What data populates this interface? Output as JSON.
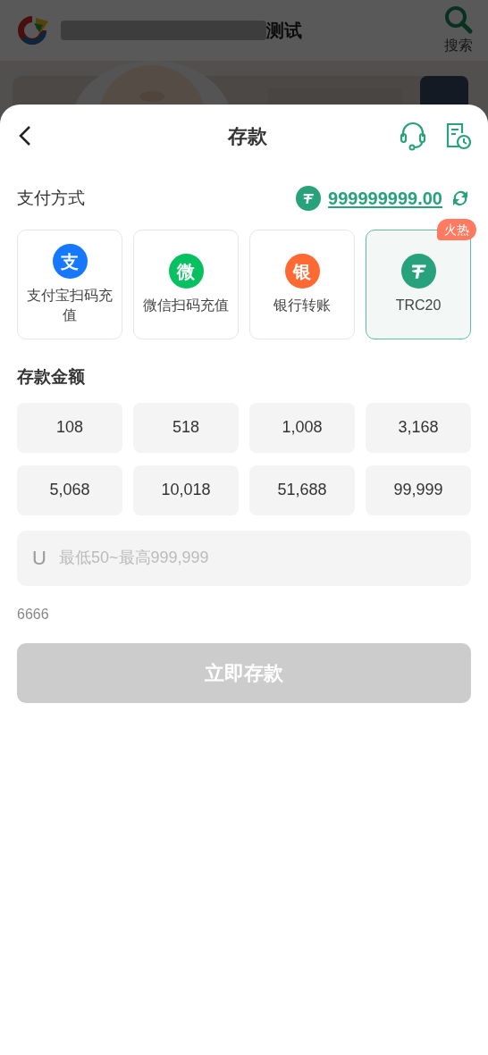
{
  "background_page": {
    "header": {
      "title_suffix": "测试",
      "search_label": "搜索"
    }
  },
  "sheet": {
    "title": "存款",
    "payment": {
      "label": "支付方式",
      "balance": "999999999.00",
      "methods": [
        {
          "kind": "glyph",
          "glyph": "支",
          "color": "#1677ff",
          "label": "支付宝扫码充值",
          "selected": false
        },
        {
          "kind": "glyph",
          "glyph": "微",
          "color": "#07c160",
          "label": "微信扫码充值",
          "selected": false
        },
        {
          "kind": "glyph",
          "glyph": "银",
          "color": "#ff6a33",
          "label": "银行转账",
          "selected": false
        },
        {
          "kind": "tether",
          "color": "#27a27b",
          "label": "TRC20",
          "badge": "火热",
          "selected": true
        }
      ]
    },
    "amount": {
      "label": "存款金额",
      "presets": [
        "108",
        "518",
        "1,008",
        "3,168",
        "5,068",
        "10,018",
        "51,688",
        "99,999"
      ],
      "currency": "U",
      "placeholder": "最低50~最高999,999",
      "note": "6666"
    },
    "submit": {
      "label": "立即存款",
      "disabled": true
    }
  }
}
